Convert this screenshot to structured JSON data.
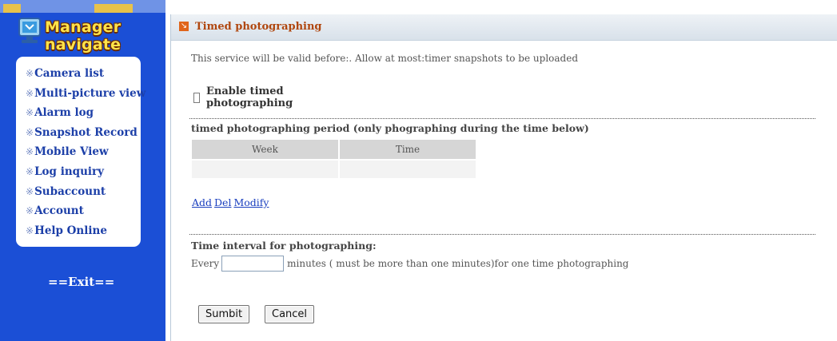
{
  "sidebar": {
    "logo_text": "Manager navigate",
    "items": [
      {
        "label": "Camera list"
      },
      {
        "label": "Multi-picture view"
      },
      {
        "label": "Alarm log"
      },
      {
        "label": "Snapshot Record"
      },
      {
        "label": "Mobile View"
      },
      {
        "label": "Log inquiry"
      },
      {
        "label": "Subaccount"
      },
      {
        "label": "Account"
      },
      {
        "label": "Help Online"
      }
    ],
    "item_bullet": "※",
    "exit_label": "==Exit=="
  },
  "panel": {
    "title": "Timed photographing",
    "validity_text": "This service will be valid before:. Allow at most:timer snapshots to be uploaded",
    "enable_label": "Enable timed photographing",
    "enable_checked": false,
    "period_label": "timed photographing period (only phographing during the time below)",
    "table_headers": {
      "week": "Week",
      "time": "Time"
    },
    "actions": {
      "add": "Add",
      "del": "Del",
      "modify": "Modify"
    },
    "interval_label": "Time interval for photographing:",
    "interval_prefix": "Every",
    "interval_value": "",
    "interval_suffix": "minutes ( must be more than one minutes)for one time photographing",
    "submit_label": "Sumbit",
    "cancel_label": "Cancel"
  },
  "colors": {
    "sidebar_bg": "#1b4fd6",
    "logo_text": "#ffe34a",
    "menu_text": "#1c3fa8",
    "title_text": "#b0470f",
    "title_icon": "#e0651b",
    "link": "#1a3fbf"
  },
  "icons": {
    "logo": "manager-monitor-icon",
    "title": "arrow-box-icon"
  }
}
